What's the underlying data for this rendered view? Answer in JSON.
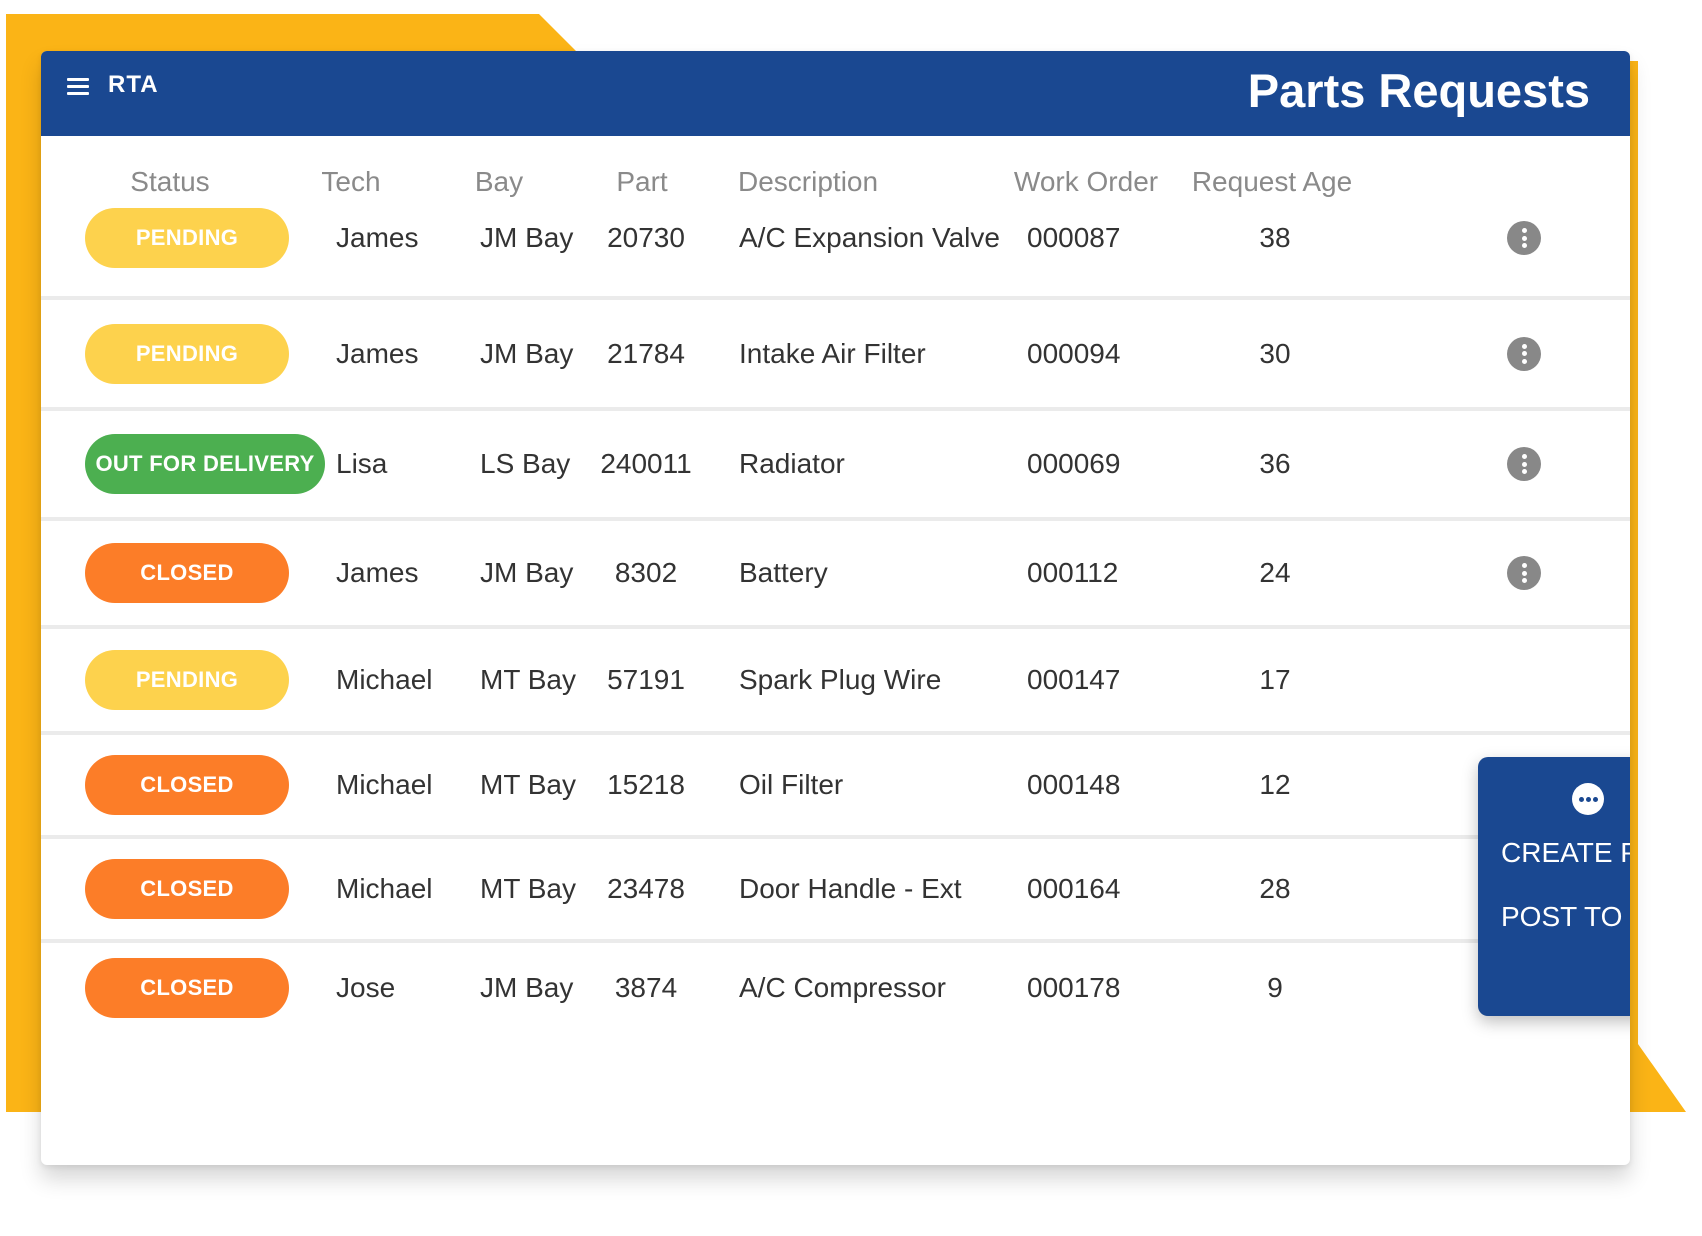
{
  "header": {
    "logo": "RTA",
    "title": "Parts Requests"
  },
  "columns": [
    "Status",
    "Tech",
    "Bay",
    "Part",
    "Description",
    "Work Order",
    "Request Age"
  ],
  "rows": [
    {
      "status": "PENDING",
      "status_type": "pending",
      "tech": "James",
      "bay": "JM Bay",
      "part": "20730",
      "description": "A/C Expansion Valve",
      "work_order": "000087",
      "age": "38"
    },
    {
      "status": "PENDING",
      "status_type": "pending",
      "tech": "James",
      "bay": "JM Bay",
      "part": "21784",
      "description": "Intake Air Filter",
      "work_order": "000094",
      "age": "30"
    },
    {
      "status": "OUT FOR DELIVERY",
      "status_type": "delivery",
      "tech": "Lisa",
      "bay": "LS Bay",
      "part": "240011",
      "description": "Radiator",
      "work_order": "000069",
      "age": "36"
    },
    {
      "status": "CLOSED",
      "status_type": "closed",
      "tech": "James",
      "bay": "JM Bay",
      "part": "8302",
      "description": "Battery",
      "work_order": "000112",
      "age": "24"
    },
    {
      "status": "PENDING",
      "status_type": "pending",
      "tech": "Michael",
      "bay": "MT Bay",
      "part": "57191",
      "description": "Spark Plug Wire",
      "work_order": "000147",
      "age": "17"
    },
    {
      "status": "CLOSED",
      "status_type": "closed",
      "tech": "Michael",
      "bay": "MT Bay",
      "part": "15218",
      "description": "Oil Filter",
      "work_order": "000148",
      "age": "12"
    },
    {
      "status": "CLOSED",
      "status_type": "closed",
      "tech": "Michael",
      "bay": "MT Bay",
      "part": "23478",
      "description": "Door Handle - Ext",
      "work_order": "000164",
      "age": "28"
    },
    {
      "status": "CLOSED",
      "status_type": "closed",
      "tech": "Jose",
      "bay": "JM Bay",
      "part": "3874",
      "description": "A/C Compressor",
      "work_order": "000178",
      "age": "9"
    }
  ],
  "context_menu": {
    "items": [
      "CREATE PO",
      "POST TO WO"
    ]
  },
  "colors": {
    "header": "#1a4891",
    "accent": "#fbb416",
    "pending": "#fdd24d",
    "delivery": "#4caf50",
    "closed": "#fc7d28"
  },
  "icons": {
    "menu": "hamburger-icon",
    "row_action": "more-vertical-icon",
    "popup": "more-horizontal-icon"
  }
}
